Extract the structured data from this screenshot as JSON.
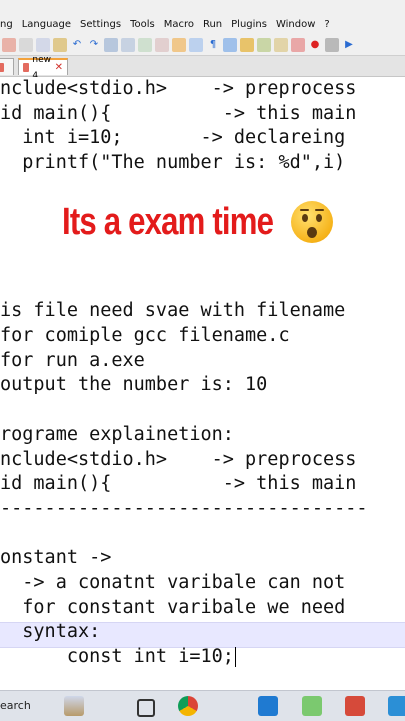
{
  "menu": [
    "ng",
    "Language",
    "Settings",
    "Tools",
    "Macro",
    "Run",
    "Plugins",
    "Window",
    "?"
  ],
  "tabs": [
    {
      "label": "",
      "active": false
    },
    {
      "label": "new 4",
      "active": true
    }
  ],
  "editor_lines": [
    "nclude<stdio.h>    -> preprocess",
    "id main(){          -> this main",
    "  int i=10;       -> declareing",
    "  printf(\"The number is: %d\",i)",
    "",
    "",
    "",
    "",
    "",
    "is file need svae with filename",
    "for comiple gcc filename.c",
    "for run a.exe",
    "output the number is: 10",
    "",
    "rograme explainetion:",
    "nclude<stdio.h>    -> preprocess",
    "id main(){          -> this main",
    "---------------------------------",
    "",
    "onstant ->",
    "  -> a conatnt varibale can not",
    "  for constant varibale we need",
    "  syntax:",
    "      const int i=10;"
  ],
  "overlay": {
    "text": "Its a exam time",
    "emoji": "astonished-face"
  },
  "taskbar": {
    "search_text": "earch"
  },
  "colors": {
    "overlay_text": "#e31b1b",
    "current_line": "#e8e8ff",
    "toolbar": "#f0f0f0"
  }
}
